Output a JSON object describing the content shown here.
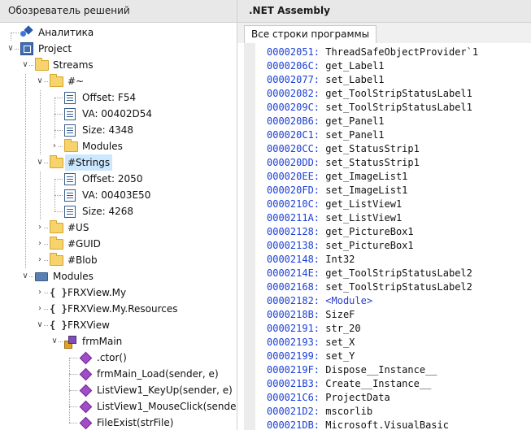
{
  "left_panel": {
    "title": "Обозреватель решений"
  },
  "right_panel": {
    "title": ".NET Assembly",
    "tab": "Все строки программы"
  },
  "tree": [
    {
      "label": "Аналитика",
      "icon": "analytics-icon",
      "depth": 0,
      "expander": "none"
    },
    {
      "label": "Project",
      "icon": "project-icon",
      "depth": 0,
      "expander": "expanded"
    },
    {
      "label": "Streams",
      "icon": "folder-icon",
      "depth": 1,
      "expander": "expanded"
    },
    {
      "label": "#~",
      "icon": "folder-open-icon",
      "depth": 2,
      "expander": "expanded"
    },
    {
      "label": "Offset: F54",
      "icon": "property-icon",
      "depth": 3,
      "expander": "none"
    },
    {
      "label": "VA: 00402D54",
      "icon": "property-icon",
      "depth": 3,
      "expander": "none"
    },
    {
      "label": "Size: 4348",
      "icon": "property-icon",
      "depth": 3,
      "expander": "none"
    },
    {
      "label": "Modules",
      "icon": "folder-icon",
      "depth": 3,
      "expander": "collapsed"
    },
    {
      "label": "#Strings",
      "icon": "folder-open-icon",
      "depth": 2,
      "expander": "expanded",
      "selected": true
    },
    {
      "label": "Offset: 2050",
      "icon": "property-icon",
      "depth": 3,
      "expander": "none"
    },
    {
      "label": "VA: 00403E50",
      "icon": "property-icon",
      "depth": 3,
      "expander": "none"
    },
    {
      "label": "Size: 4268",
      "icon": "property-icon",
      "depth": 3,
      "expander": "none"
    },
    {
      "label": "#US",
      "icon": "folder-icon",
      "depth": 2,
      "expander": "collapsed"
    },
    {
      "label": "#GUID",
      "icon": "folder-icon",
      "depth": 2,
      "expander": "collapsed"
    },
    {
      "label": "#Blob",
      "icon": "folder-icon",
      "depth": 2,
      "expander": "collapsed"
    },
    {
      "label": "Modules",
      "icon": "module-icon",
      "depth": 1,
      "expander": "expanded"
    },
    {
      "label": "FRXView.My",
      "icon": "namespace-icon",
      "depth": 2,
      "expander": "collapsed"
    },
    {
      "label": "FRXView.My.Resources",
      "icon": "namespace-icon",
      "depth": 2,
      "expander": "collapsed"
    },
    {
      "label": "FRXView",
      "icon": "namespace-icon",
      "depth": 2,
      "expander": "expanded"
    },
    {
      "label": "frmMain",
      "icon": "class-icon",
      "depth": 3,
      "expander": "expanded"
    },
    {
      "label": ".ctor()",
      "icon": "method-icon",
      "depth": 4,
      "expander": "none"
    },
    {
      "label": "frmMain_Load(sender, e)",
      "icon": "method-icon",
      "depth": 4,
      "expander": "none"
    },
    {
      "label": "ListView1_KeyUp(sender, e)",
      "icon": "method-icon",
      "depth": 4,
      "expander": "none"
    },
    {
      "label": "ListView1_MouseClick(sende",
      "icon": "method-icon",
      "depth": 4,
      "expander": "none"
    },
    {
      "label": "FileExist(strFile)",
      "icon": "method-icon",
      "depth": 4,
      "expander": "none"
    }
  ],
  "strings": [
    {
      "addr": "00002051:",
      "text": "ThreadSafeObjectProvider`1"
    },
    {
      "addr": "0000206C:",
      "text": "get_Label1"
    },
    {
      "addr": "00002077:",
      "text": "set_Label1"
    },
    {
      "addr": "00002082:",
      "text": "get_ToolStripStatusLabel1"
    },
    {
      "addr": "0000209C:",
      "text": "set_ToolStripStatusLabel1"
    },
    {
      "addr": "000020B6:",
      "text": "get_Panel1"
    },
    {
      "addr": "000020C1:",
      "text": "set_Panel1"
    },
    {
      "addr": "000020CC:",
      "text": "get_StatusStrip1"
    },
    {
      "addr": "000020DD:",
      "text": "set_StatusStrip1"
    },
    {
      "addr": "000020EE:",
      "text": "get_ImageList1"
    },
    {
      "addr": "000020FD:",
      "text": "set_ImageList1"
    },
    {
      "addr": "0000210C:",
      "text": "get_ListView1"
    },
    {
      "addr": "0000211A:",
      "text": "set_ListView1"
    },
    {
      "addr": "00002128:",
      "text": "get_PictureBox1"
    },
    {
      "addr": "00002138:",
      "text": "set_PictureBox1"
    },
    {
      "addr": "00002148:",
      "text": "Int32"
    },
    {
      "addr": "0000214E:",
      "text": "get_ToolStripStatusLabel2"
    },
    {
      "addr": "00002168:",
      "text": "set_ToolStripStatusLabel2"
    },
    {
      "addr": "00002182:",
      "text": "<Module>",
      "keyword": true
    },
    {
      "addr": "0000218B:",
      "text": "SizeF"
    },
    {
      "addr": "00002191:",
      "text": "str_20"
    },
    {
      "addr": "00002193:",
      "text": "set_X"
    },
    {
      "addr": "00002199:",
      "text": "set_Y"
    },
    {
      "addr": "0000219F:",
      "text": "Dispose__Instance__"
    },
    {
      "addr": "000021B3:",
      "text": "Create__Instance__"
    },
    {
      "addr": "000021C6:",
      "text": "ProjectData"
    },
    {
      "addr": "000021D2:",
      "text": "mscorlib"
    },
    {
      "addr": "000021DB:",
      "text": "Microsoft.VisualBasic"
    }
  ]
}
